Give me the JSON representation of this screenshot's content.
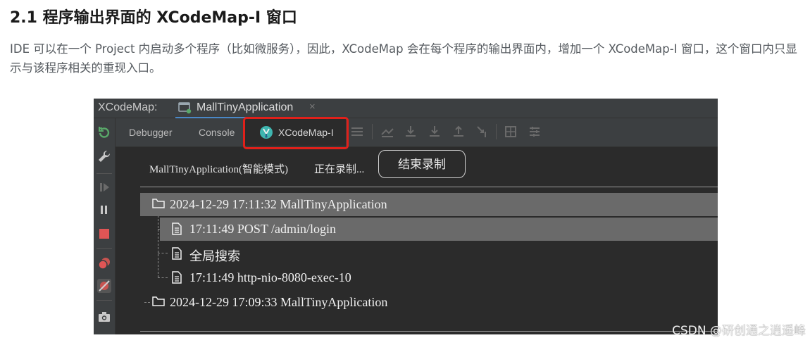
{
  "heading": "2.1 程序输出界面的 XCodeMap-I 窗口",
  "paragraph": "IDE 可以在一个 Project 内启动多个程序（比如微服务），因此，XCodeMap 会在每个程序的输出界面内，增加一个 XCodeMap-I 窗口，这个窗口内只显示与该程序相关的重现入口。",
  "screenshot": {
    "tabbar_label": "XCodeMap:",
    "run_tab": "MallTinyApplication",
    "close_glyph": "×",
    "toolbar_tabs": [
      "Debugger",
      "Console",
      "XCodeMap-I"
    ],
    "app_mode_label": "MallTinyApplication(智能模式)",
    "recording_status": "正在录制...",
    "stop_button": "结束录制",
    "tree": [
      {
        "level": 0,
        "type": "folder",
        "text": "2024-12-29 17:11:32 MallTinyApplication",
        "selected": true
      },
      {
        "level": 1,
        "type": "file",
        "text": "17:11:49 POST /admin/login",
        "selected": true
      },
      {
        "level": 1,
        "type": "file",
        "text": "全局搜索",
        "selected": false
      },
      {
        "level": 1,
        "type": "file",
        "text": "17:11:49 http-nio-8080-exec-10",
        "selected": false
      },
      {
        "level": 0,
        "type": "folder",
        "text": "2024-12-29 17:09:33 MallTinyApplication",
        "selected": false
      }
    ],
    "left_icons": [
      "rerun-icon",
      "wrench-icon",
      "resume-icon",
      "pause-icon",
      "stop-icon",
      "view-breakpoints-icon",
      "mute-breakpoints-icon",
      "camera-icon"
    ],
    "colors": {
      "highlight": "#e0201a",
      "ide_bg": "#2b2b2b",
      "panel_bg": "#3c3f41",
      "selection": "#6a6a6a"
    }
  },
  "watermark": "CSDN @研创通之逍遥峰"
}
